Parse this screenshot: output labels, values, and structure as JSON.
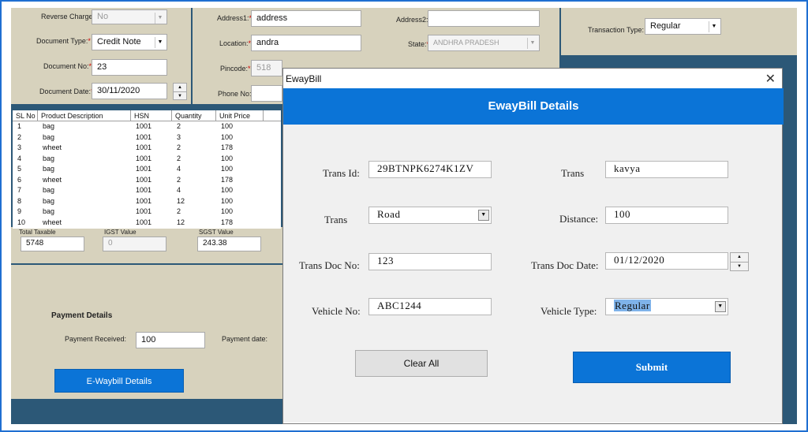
{
  "form": {
    "reverse_charge": {
      "label": "Reverse Charge",
      "value": "No"
    },
    "document_type": {
      "label": "Document Type:",
      "value": "Credit Note"
    },
    "document_no": {
      "label": "Document No:",
      "value": "23"
    },
    "document_date": {
      "label": "Document Date:",
      "value": "30/11/2020"
    },
    "address1": {
      "label": "Address1:",
      "value": "address"
    },
    "location": {
      "label": "Location:",
      "value": "andra"
    },
    "pincode": {
      "label": "Pincode:",
      "value": "518"
    },
    "phone_no": {
      "label": "Phone No:",
      "value": ""
    },
    "address2": {
      "label": "Address2:",
      "value": ""
    },
    "state": {
      "label": "State:",
      "value": "ANDHRA PRADESH"
    },
    "transaction_type": {
      "label": "Transaction Type:",
      "value": "Regular"
    },
    "required_mark": "*"
  },
  "grid": {
    "columns": [
      "SL No",
      "Product Description",
      "HSN",
      "Quantity",
      "Unit Price"
    ],
    "rows": [
      [
        "1",
        "bag",
        "1001",
        "2",
        "100"
      ],
      [
        "2",
        "bag",
        "1001",
        "3",
        "100"
      ],
      [
        "3",
        "wheet",
        "1001",
        "2",
        "178"
      ],
      [
        "4",
        "bag",
        "1001",
        "2",
        "100"
      ],
      [
        "5",
        "bag",
        "1001",
        "4",
        "100"
      ],
      [
        "6",
        "wheet",
        "1001",
        "2",
        "178"
      ],
      [
        "7",
        "bag",
        "1001",
        "4",
        "100"
      ],
      [
        "8",
        "bag",
        "1001",
        "12",
        "100"
      ],
      [
        "9",
        "bag",
        "1001",
        "2",
        "100"
      ],
      [
        "10",
        "wheet",
        "1001",
        "12",
        "178"
      ]
    ]
  },
  "totals": {
    "total_taxable": {
      "label": "Total Taxable",
      "value": "5748"
    },
    "igst": {
      "label": "IGST Value",
      "value": "0"
    },
    "sgst": {
      "label": "SGST Value",
      "value": "243.38"
    }
  },
  "payment": {
    "heading": "Payment Details",
    "received_label": "Payment Received:",
    "received_value": "100",
    "date_label": "Payment date:"
  },
  "ewaybill_button": "E-Waybill Details",
  "dialog": {
    "window_title": "EwayBill",
    "close_glyph": "✕",
    "header": "EwayBill Details",
    "trans_id": {
      "label": "Trans Id:",
      "value": "29BTNPK6274K1ZV"
    },
    "trans_name": {
      "label": "Trans",
      "value": "kavya"
    },
    "trans_mode": {
      "label": "Trans",
      "value": "Road"
    },
    "distance": {
      "label": "Distance:",
      "value": "100"
    },
    "trans_doc_no": {
      "label": "Trans Doc No:",
      "value": "123"
    },
    "trans_doc_date": {
      "label": "Trans Doc Date:",
      "value": "01/12/2020"
    },
    "vehicle_no": {
      "label": "Vehicle No:",
      "value": "ABC1244"
    },
    "vehicle_type": {
      "label": "Vehicle Type:",
      "value": "Regular"
    },
    "clear_button": "Clear All",
    "submit_button": "Submit"
  },
  "icons": {
    "dropdown": "▼",
    "spin_up": "▲",
    "spin_down": "▼"
  },
  "colors": {
    "accent": "#0b74d7",
    "form_bg": "#d7d2bd",
    "app_bg": "#2c5877",
    "required": "#d00000"
  }
}
